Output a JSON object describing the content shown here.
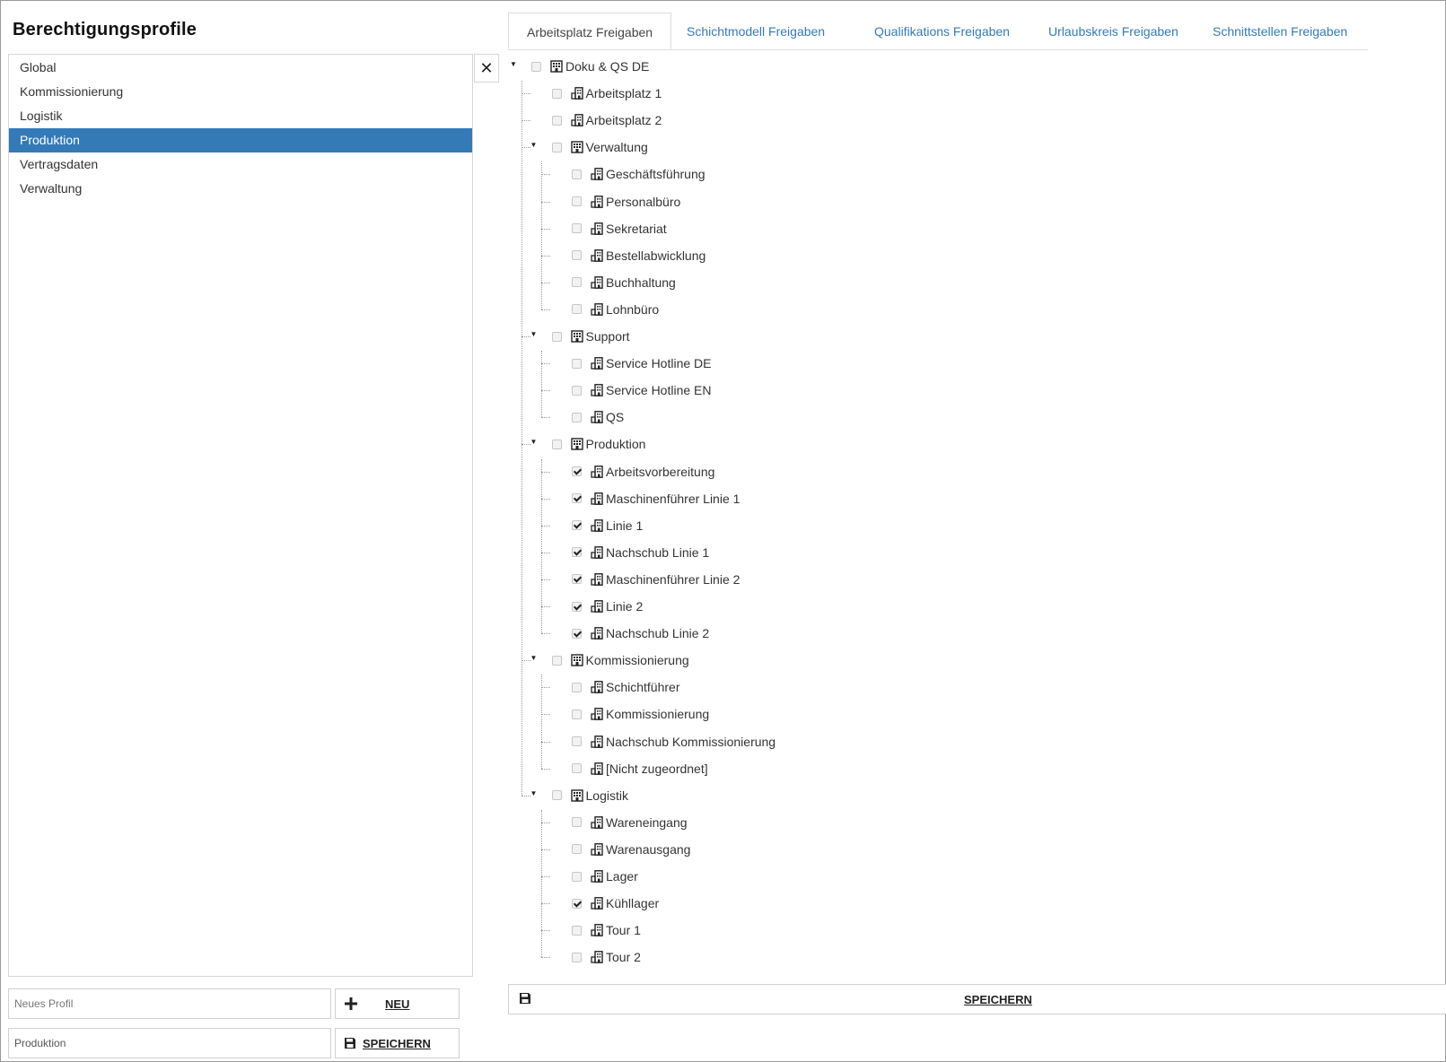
{
  "title": "Berechtigungsprofile",
  "profiles": [
    "Global",
    "Kommissionierung",
    "Logistik",
    "Produktion",
    "Vertragsdaten",
    "Verwaltung"
  ],
  "selected_profile": "Produktion",
  "close_label": "✕",
  "new_profile": {
    "placeholder": "Neues Profil",
    "button_label": "NEU"
  },
  "edit_profile": {
    "value": "Produktion",
    "button_label": "SPEICHERN"
  },
  "tabs": [
    {
      "label": "Arbeitsplatz Freigaben",
      "active": true
    },
    {
      "label": "Schichtmodell Freigaben",
      "active": false
    },
    {
      "label": "Qualifikations Freigaben",
      "active": false
    },
    {
      "label": "Urlaubskreis Freigaben",
      "active": false
    },
    {
      "label": "Schnittstellen Freigaben",
      "active": false
    }
  ],
  "tree": {
    "root": {
      "label": "Doku & QS DE",
      "checked": false,
      "expanded": true
    },
    "direct_items": [
      {
        "label": "Arbeitsplatz 1",
        "checked": false
      },
      {
        "label": "Arbeitsplatz 2",
        "checked": false
      }
    ],
    "groups": [
      {
        "label": "Verwaltung",
        "checked": false,
        "expanded": true,
        "items": [
          {
            "label": "Geschäftsführung",
            "checked": false
          },
          {
            "label": "Personalbüro",
            "checked": false
          },
          {
            "label": "Sekretariat",
            "checked": false
          },
          {
            "label": "Bestellabwicklung",
            "checked": false
          },
          {
            "label": "Buchhaltung",
            "checked": false
          },
          {
            "label": "Lohnbüro",
            "checked": false
          }
        ]
      },
      {
        "label": "Support",
        "checked": false,
        "expanded": true,
        "items": [
          {
            "label": "Service Hotline DE",
            "checked": false
          },
          {
            "label": "Service Hotline EN",
            "checked": false
          },
          {
            "label": "QS",
            "checked": false
          }
        ]
      },
      {
        "label": "Produktion",
        "checked": false,
        "expanded": true,
        "items": [
          {
            "label": "Arbeitsvorbereitung",
            "checked": true
          },
          {
            "label": "Maschinenführer Linie 1",
            "checked": true
          },
          {
            "label": "Linie 1",
            "checked": true
          },
          {
            "label": "Nachschub Linie 1",
            "checked": true
          },
          {
            "label": "Maschinenführer Linie 2",
            "checked": true
          },
          {
            "label": "Linie 2",
            "checked": true
          },
          {
            "label": "Nachschub Linie 2",
            "checked": true
          }
        ]
      },
      {
        "label": "Kommissionierung",
        "checked": false,
        "expanded": true,
        "items": [
          {
            "label": "Schichtführer",
            "checked": false
          },
          {
            "label": "Kommissionierung",
            "checked": false
          },
          {
            "label": "Nachschub Kommissionierung",
            "checked": false
          },
          {
            "label": "[Nicht zugeordnet]",
            "checked": false
          }
        ]
      },
      {
        "label": "Logistik",
        "checked": false,
        "expanded": true,
        "items": [
          {
            "label": "Wareneingang",
            "checked": false
          },
          {
            "label": "Warenausgang",
            "checked": false
          },
          {
            "label": "Lager",
            "checked": false
          },
          {
            "label": "Kühllager",
            "checked": true
          },
          {
            "label": "Tour 1",
            "checked": false
          },
          {
            "label": "Tour 2",
            "checked": false
          }
        ]
      }
    ]
  },
  "save_bar_label": "SPEICHERN",
  "icons": {
    "group": "building-icon",
    "item": "workstation-icon",
    "save": "floppy-disk-icon",
    "add": "plus-icon",
    "close": "close-icon"
  },
  "colors": {
    "selected_bg": "#337ab7",
    "tab_link": "#337ab7"
  }
}
